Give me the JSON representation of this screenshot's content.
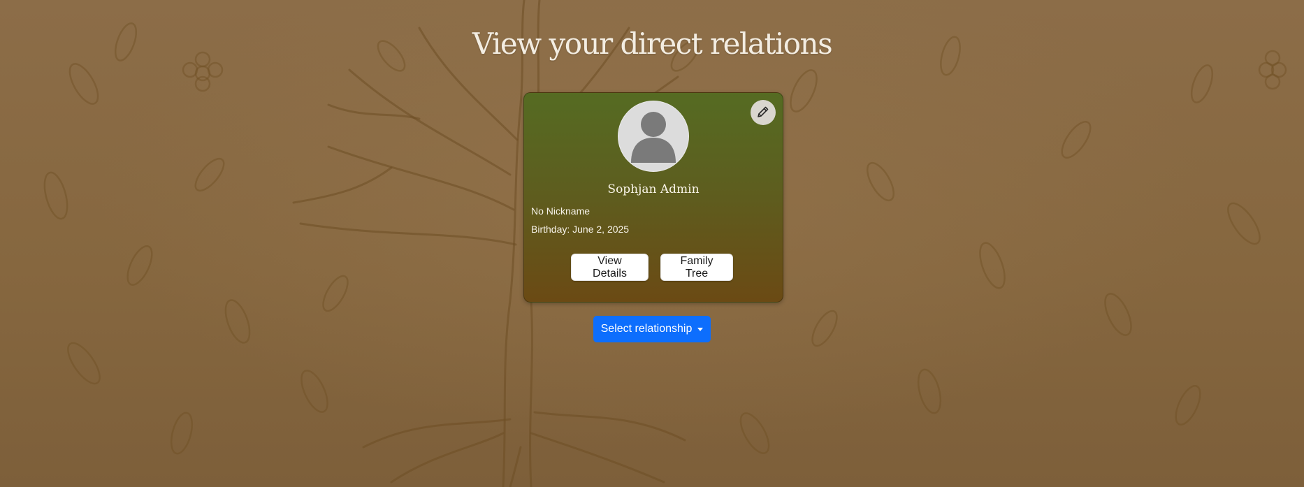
{
  "page": {
    "title": "View your direct relations"
  },
  "card": {
    "name": "Sophjan Admin",
    "nickname": "No Nickname",
    "birthday": "Birthday: June 2, 2025",
    "edit_icon": "pencil-icon",
    "avatar_icon": "person-icon",
    "view_details_label": "View Details",
    "family_tree_label": "Family Tree"
  },
  "relationship": {
    "select_label": "Select relationship"
  },
  "colors": {
    "primary_button": "#0d6efd",
    "card_top": "#556b22",
    "card_bottom": "#6b4a14",
    "background": "#8a6b45"
  }
}
